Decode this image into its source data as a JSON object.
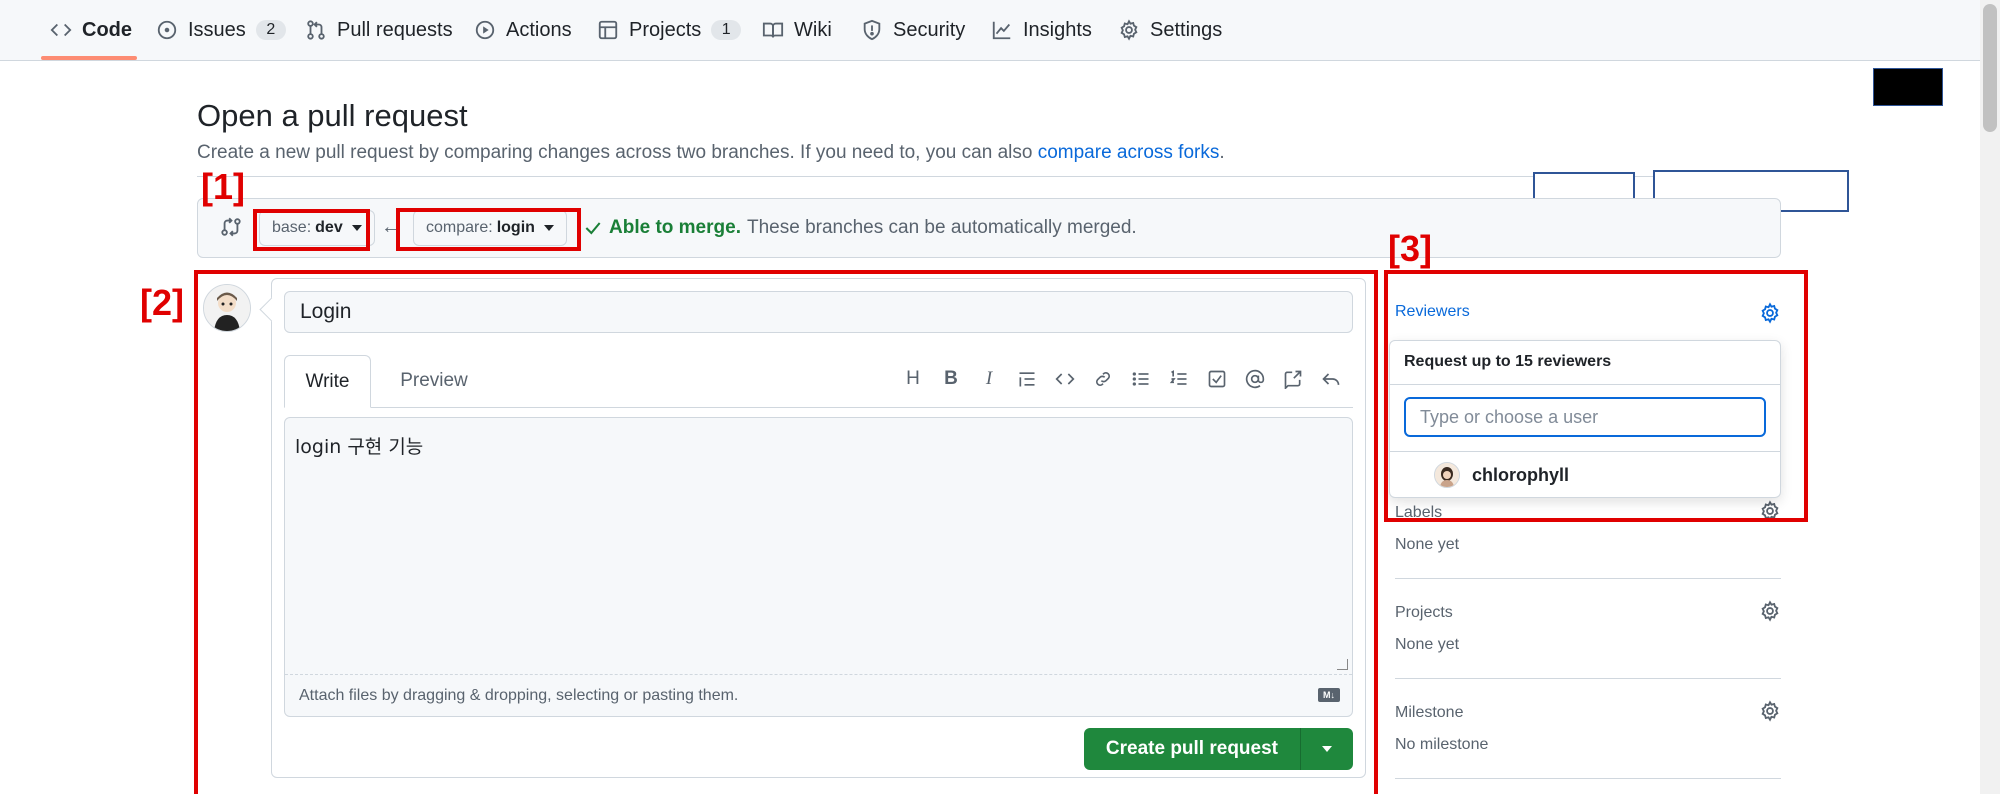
{
  "nav": {
    "items": [
      {
        "label": "Code",
        "icon": "code-icon",
        "active": true
      },
      {
        "label": "Issues",
        "icon": "issue-icon",
        "count": "2"
      },
      {
        "label": "Pull requests",
        "icon": "pull-request-icon"
      },
      {
        "label": "Actions",
        "icon": "play-icon"
      },
      {
        "label": "Projects",
        "icon": "table-icon",
        "count": "1"
      },
      {
        "label": "Wiki",
        "icon": "book-icon"
      },
      {
        "label": "Security",
        "icon": "shield-icon"
      },
      {
        "label": "Insights",
        "icon": "graph-icon"
      },
      {
        "label": "Settings",
        "icon": "gear-icon"
      }
    ]
  },
  "header": {
    "title": "Open a pull request",
    "description": "Create a new pull request by comparing changes across two branches. If you need to, you can also",
    "link": "compare across forks",
    "link_suffix": "."
  },
  "compare": {
    "base_prefix": "base:",
    "base_branch": "dev",
    "compare_prefix": "compare:",
    "compare_branch": "login",
    "merge_ok": "Able to merge.",
    "merge_msg": "These branches can be automatically merged."
  },
  "annotations": {
    "one": "[1]",
    "two": "[2]",
    "three": "[3]"
  },
  "form": {
    "title_value": "Login",
    "tabs": {
      "write": "Write",
      "preview": "Preview"
    },
    "toolbar": {
      "heading": "H",
      "bold": "B",
      "italic": "I"
    },
    "body": "login 구현 기능",
    "attach_hint": "Attach files by dragging & dropping, selecting or pasting them.",
    "markdown_badge": "M↓",
    "submit": "Create pull request"
  },
  "sidebar": {
    "reviewers": {
      "heading": "Reviewers",
      "popover_title": "Request up to 15 reviewers",
      "placeholder": "Type or choose a user",
      "suggested_user": "chlorophyll"
    },
    "labels": {
      "heading": "Labels",
      "value": "None yet"
    },
    "projects": {
      "heading": "Projects",
      "value": "None yet"
    },
    "milestone": {
      "heading": "Milestone",
      "value": "No milestone"
    }
  },
  "colors": {
    "accent": "#0969da",
    "success": "#1f883d",
    "annotation": "#e00000",
    "underline": "#fd8c73"
  }
}
